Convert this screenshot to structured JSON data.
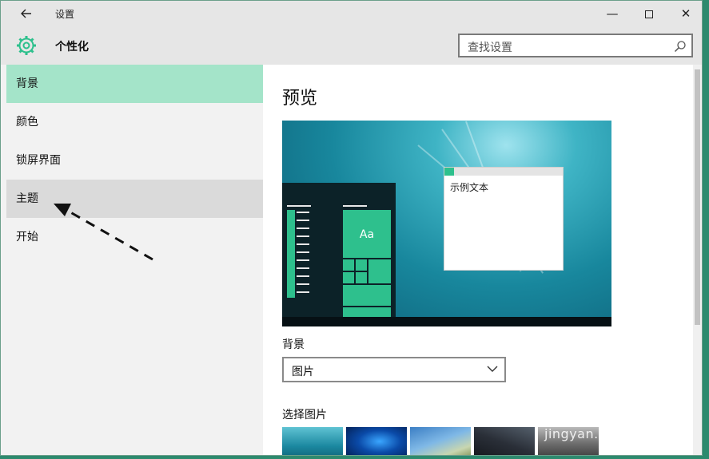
{
  "window": {
    "title": "设置",
    "back_icon": "back-arrow-icon",
    "minimize_glyph": "—",
    "close_glyph": "✕"
  },
  "header": {
    "icon": "gear-icon",
    "title": "个性化",
    "search_placeholder": "查找设置",
    "accent_color": "#2ec08d"
  },
  "sidebar": {
    "items": [
      {
        "label": "背景"
      },
      {
        "label": "颜色"
      },
      {
        "label": "锁屏界面"
      },
      {
        "label": "主题"
      },
      {
        "label": "开始"
      }
    ],
    "selected": "背景",
    "hovered": "主题",
    "selected_color": "#a4e4c9"
  },
  "main": {
    "heading": "预览",
    "preview_tile_text": "Aa",
    "preview_window_text": "示例文本",
    "background_label": "背景",
    "background_value": "图片",
    "choose_picture_label": "选择图片"
  },
  "watermark": {
    "text": "jingyan.baidu.com"
  }
}
